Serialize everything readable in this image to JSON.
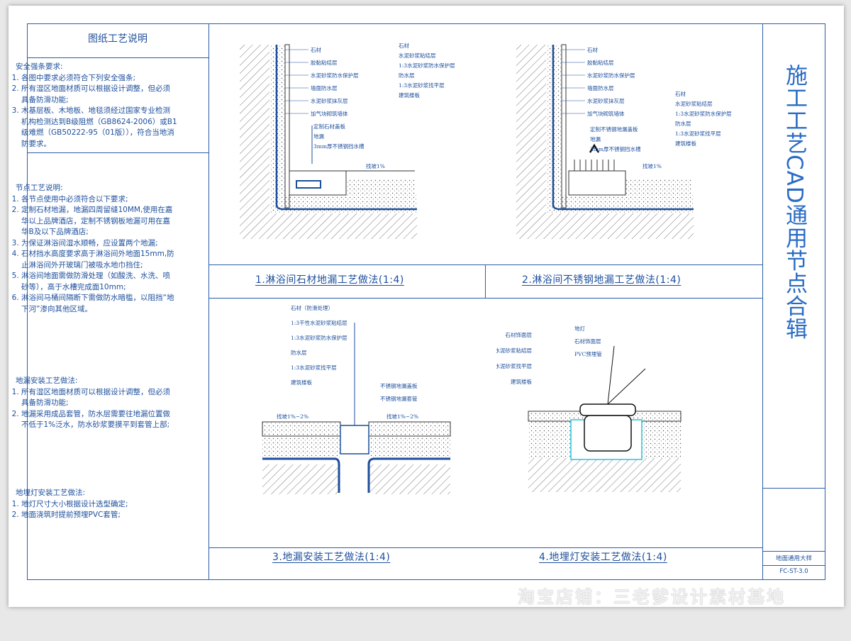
{
  "notes": {
    "title": "图纸工艺说明",
    "safety": {
      "heading": "安全强条要求:",
      "items": [
        "各图中要求必须符合下列安全强条;",
        "所有湿区地面材质可以根据设计调整，但必须具备防滑功能;",
        "木基层板、木地板、地毯须经过国家专业检测机构检测达到B级阻燃（GB8624-2006）或B1级难燃（GB50222-95（01版）），符合当地消防要求。"
      ]
    },
    "node": {
      "heading": "节点工艺说明:",
      "items": [
        "各节点使用中必须符合以下要求;",
        "定制石材地漏，地漏四周留缝10MM,使用在嘉华以上品牌酒店，定制不锈钢板地漏可用在嘉华B及以下品牌酒店;",
        "为保证淋浴间湿水顺畅，应设置两个地漏;",
        "石材挡水高度要求高于淋浴间外地面15mm,防止淋浴间外开玻璃门被吸水地巾挡住;",
        "淋浴间地面需做防滑处理（如酸洗、水洗、喷砂等），高于水槽完成面10mm;",
        "淋浴间马桶间隔断下需做防水暗槛，以阻挡“地下河”渗向其他区域。"
      ]
    },
    "drain": {
      "heading": "地漏安装工艺做法:",
      "items": [
        "所有湿区地面材质可以根据设计调整，但必须具备防滑功能;",
        "地漏采用成品套管，防水层需要往地漏位置做不低于1%泛水，防水砂浆要摸平到套管上部;"
      ]
    },
    "lamp": {
      "heading": "地埋灯安装工艺做法:",
      "items": [
        "地灯尺寸大小根据设计选型确定;",
        "地面浇筑时提前预埋PVC套管;"
      ]
    }
  },
  "captions": {
    "d1": "1.淋浴间石材地漏工艺做法(1:4)",
    "d2": "2.淋浴间不锈钢地漏工艺做法(1:4)",
    "d3": "3.地漏安装工艺做法(1:4)",
    "d4": "4.地埋灯安装工艺做法(1:4)"
  },
  "labels": {
    "d1_wall": [
      "石材",
      "胶黏粘结层",
      "水泥砂浆防水保护层",
      "墙面防水层",
      "水泥砂浆抹灰层",
      "加气块砌筑墙体"
    ],
    "d1_floor": [
      "石材",
      "水泥砂浆粘结层",
      "1:3水泥砂浆防水保护层",
      "防水层",
      "1:3水泥砂浆找平层",
      "建筑楼板"
    ],
    "d1_mid": [
      "定制石材盖板",
      "地漏",
      "3mm厚不锈钢挡水槽"
    ],
    "d2_wall": [
      "石材",
      "胶黏粘结层",
      "水泥砂浆防水保护层",
      "墙面防水层",
      "水泥砂浆抹灰层",
      "加气块砌筑墙体"
    ],
    "d2_floor": [
      "石材",
      "水泥砂浆粘结层",
      "1:3水泥砂浆防水保护层",
      "防水层",
      "1:3水泥砂浆找平层",
      "建筑楼板"
    ],
    "d2_mid": [
      "定制不锈钢地漏盖板",
      "地漏",
      "3mm厚不锈钢挡水槽"
    ],
    "d3_left": [
      "石材（防滑处理）",
      "1:3干性水泥砂浆粘结层",
      "1:3水泥砂浆防水保护层",
      "防水层",
      "1:3水泥砂浆找平层",
      "建筑楼板"
    ],
    "d3_right": [
      "不锈钢地漏盖板",
      "不锈钢地漏套管"
    ],
    "d4_left": [
      "石材饰面层",
      "水泥砂浆粘结层",
      "水泥砂浆找平层",
      "建筑楼板"
    ],
    "d4_top": [
      "地灯",
      "石材饰面层",
      "PVC预埋管"
    ],
    "slope": [
      "找坡1%",
      "找坡1%~2%"
    ]
  },
  "side": {
    "title": "施工工艺CAD通用节点合辑",
    "sheet_name": "地面通用大样",
    "sheet_no": "FC-ST-3.0"
  },
  "watermark": "淘宝店铺：三老爹设计素材基地"
}
